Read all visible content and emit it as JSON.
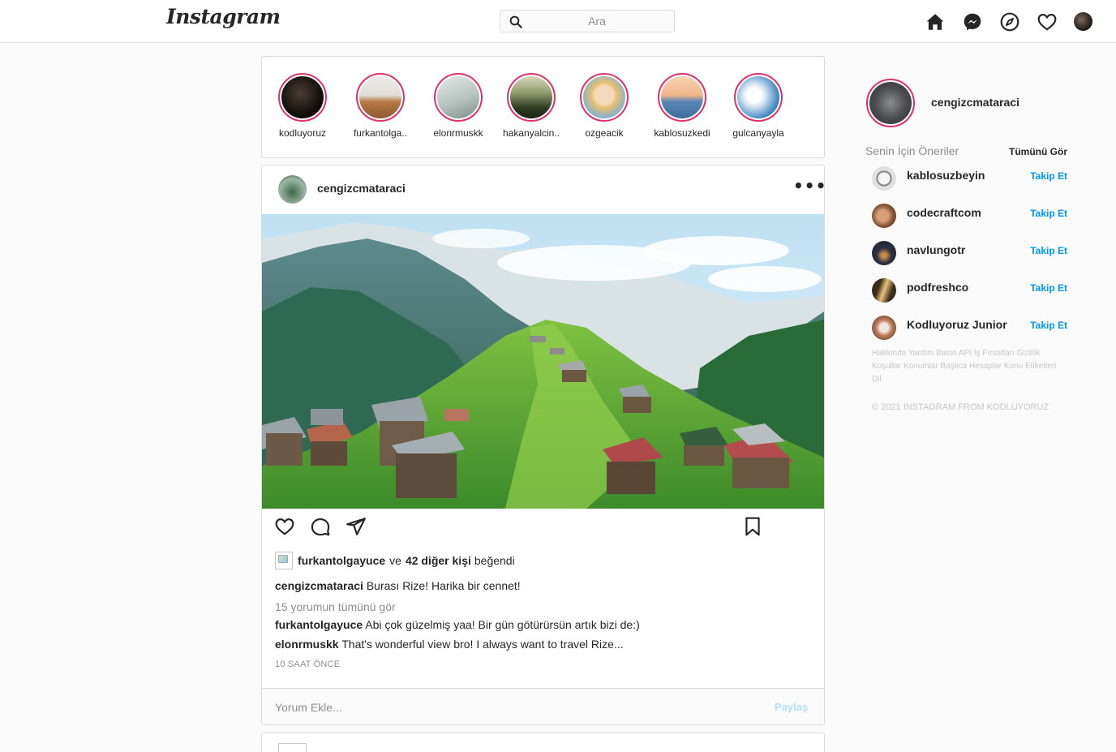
{
  "header": {
    "logo": "Instagram",
    "search_placeholder": "Ara",
    "icons": [
      "home-icon",
      "messenger-icon",
      "explore-icon",
      "heart-icon",
      "profile-avatar"
    ]
  },
  "stories": [
    {
      "name": "kodluyoruz",
      "colors": [
        "#3a2e28",
        "#0f0c0a"
      ]
    },
    {
      "name": "furkantolga..",
      "colors": [
        "#e7e3df",
        "#b77a45"
      ]
    },
    {
      "name": "elonrmuskk",
      "colors": [
        "#d3dad7",
        "#8a9c95"
      ]
    },
    {
      "name": "hakanyalcin..",
      "colors": [
        "#c9c8a8",
        "#2e3a24"
      ]
    },
    {
      "name": "ozgeacik",
      "colors": [
        "#f1d2b5",
        "#7ab0d8"
      ]
    },
    {
      "name": "kablosuzkedi",
      "colors": [
        "#f3c7a2",
        "#5a86b5"
      ]
    },
    {
      "name": "gulcanyayla",
      "colors": [
        "#e4eef5",
        "#3e86c2"
      ]
    }
  ],
  "post": {
    "username": "cengizcmataraci",
    "more": "•••",
    "liked_by_user": "furkantolgayuce",
    "liked_connector": "ve",
    "liked_others": "42 diğer kişi",
    "liked_suffix": "beğendi",
    "caption_user": "cengizcmataraci",
    "caption_text": "Burası Rize! Harika bir cennet!",
    "view_all_comments": "15 yorumun tümünü gör",
    "comments": [
      {
        "user": "furkantolgayuce",
        "text": "Abi çok güzelmiş yaa! Bir gün götürürsün artık bizi de:)"
      },
      {
        "user": "elonrmuskk",
        "text": "That's wonderful view bro! I always want to travel Rize..."
      }
    ],
    "time": "10 SAAT ÖNCE",
    "comment_placeholder": "Yorum Ekle...",
    "share_label": "Paylaş"
  },
  "sidebar": {
    "profile_name": "cengizcmataraci",
    "suggestions_title": "Senin İçin Öneriler",
    "see_all": "Tümünü Gör",
    "suggestions": [
      {
        "name": "kablosuzbeyin",
        "follow": "Takip Et",
        "colors": [
          "#f0f0f0",
          "#555"
        ]
      },
      {
        "name": "codecraftcom",
        "follow": "Takip Et",
        "colors": [
          "#d8a07a",
          "#3b2418"
        ]
      },
      {
        "name": "navlungotr",
        "follow": "Takip Et",
        "colors": [
          "#c88a4a",
          "#1e2430"
        ]
      },
      {
        "name": "podfreshco",
        "follow": "Takip Et",
        "colors": [
          "#e9c27a",
          "#3a2b1a"
        ]
      },
      {
        "name": "Kodluyoruz Junior",
        "follow": "Takip Et",
        "colors": [
          "#f2e6dc",
          "#8a5a3a"
        ]
      }
    ],
    "footer_links": "Hakkında Yardım Basın API İş Fırsatları Gizlilik Koşullar Konumlar Başlıca Hesaplar Konu Etiketleri Dil",
    "copyright": "© 2021 INSTAGRAM FROM KODLUYORUZ"
  }
}
